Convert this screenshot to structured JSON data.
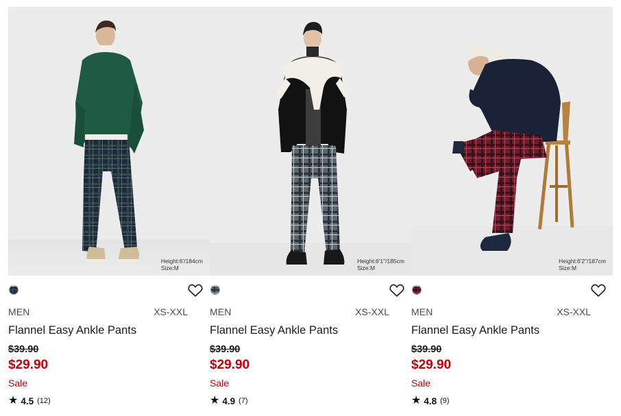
{
  "products": [
    {
      "photo_caption": [
        "Height:6'/184cm",
        "Size:M"
      ],
      "swatch_color": "#1f2e45",
      "gender": "MEN",
      "sizes": "XS-XXL",
      "name": "Flannel Easy Ankle Pants",
      "original_price": "$39.90",
      "sale_price": "$29.90",
      "flag": "Sale",
      "rating": "4.5",
      "review_count": "(12)"
    },
    {
      "photo_caption": [
        "Height:6'1\"/185cm",
        "Size:M"
      ],
      "swatch_color": "#52606a",
      "gender": "MEN",
      "sizes": "XS-XXL",
      "name": "Flannel Easy Ankle Pants",
      "original_price": "$39.90",
      "sale_price": "$29.90",
      "flag": "Sale",
      "rating": "4.9",
      "review_count": "(7)"
    },
    {
      "photo_caption": [
        "Height:6'2\"/187cm",
        "Size:M"
      ],
      "swatch_color": "#6b1d2c",
      "gender": "MEN",
      "sizes": "XS-XXL",
      "name": "Flannel Easy Ankle Pants",
      "original_price": "$39.90",
      "sale_price": "$29.90",
      "flag": "Sale",
      "rating": "4.8",
      "review_count": "(9)"
    }
  ],
  "colors": {
    "sale_red": "#c3000d",
    "text": "#1b1b1b",
    "muted": "#4a4a4a"
  },
  "icons": {
    "favorite": "heart-outline-icon",
    "rating": "star-icon"
  }
}
